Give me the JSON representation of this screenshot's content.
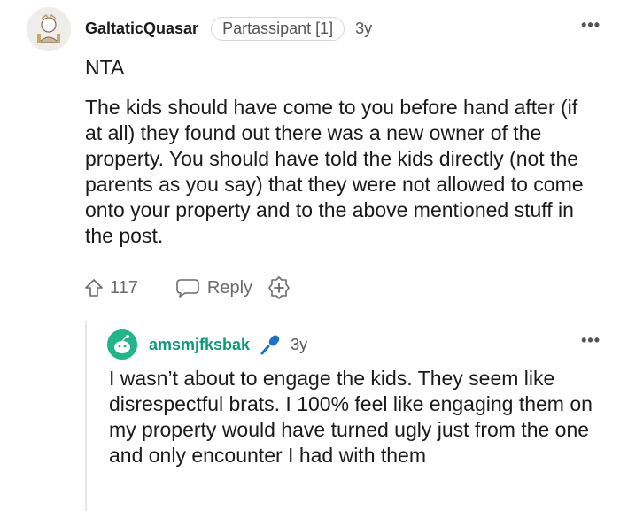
{
  "comment": {
    "username": "GaltaticQuasar",
    "flair": "Partassipant [1]",
    "age": "3y",
    "more_label": "•••",
    "verdict": "NTA",
    "body": "The kids should have come to you before hand after (if at all) they found out there was a new owner of the property. You should have told the kids directly (not the parents as you say) that they were not allowed to come onto your property and to the above mentioned stuff in the post.",
    "vote_count": "117",
    "reply_label": "Reply"
  },
  "reply": {
    "username": "amsmjfksbak",
    "age": "3y",
    "more_label": "•••",
    "body": "I wasn’t about to engage the kids. They seem like disrespectful brats. I 100% feel like engaging them on my property would have turned ugly just from the one and only encounter I had with them",
    "username_color": "#0a9b7a",
    "avatar_color": "#20b68a",
    "mic_color": "#1a73c9"
  },
  "icons": {
    "upvote": "upvote-arrow-icon",
    "reply": "speech-bubble-icon",
    "award": "award-plus-icon",
    "mic": "microphone-icon",
    "more": "more-dots-icon"
  }
}
